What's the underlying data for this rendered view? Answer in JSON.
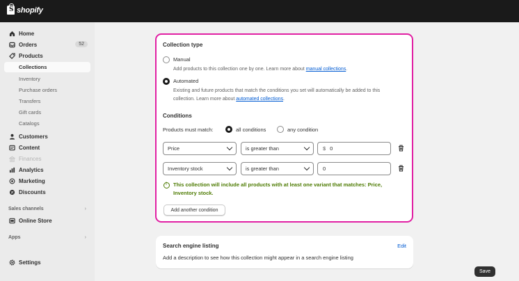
{
  "app": {
    "brand": "shopify"
  },
  "sidebar": {
    "items": [
      {
        "label": "Home",
        "icon": "home-icon"
      },
      {
        "label": "Orders",
        "icon": "orders-icon",
        "badge": "52"
      },
      {
        "label": "Products",
        "icon": "tag-icon"
      }
    ],
    "product_sub": [
      "Collections",
      "Inventory",
      "Purchase orders",
      "Transfers",
      "Gift cards",
      "Catalogs"
    ],
    "items2": [
      {
        "label": "Customers",
        "icon": "person-icon"
      },
      {
        "label": "Content",
        "icon": "content-icon"
      },
      {
        "label": "Finances",
        "icon": "bank-icon",
        "disabled": true
      },
      {
        "label": "Analytics",
        "icon": "chart-icon"
      },
      {
        "label": "Marketing",
        "icon": "target-icon"
      },
      {
        "label": "Discounts",
        "icon": "discount-icon"
      }
    ],
    "sales_channels_label": "Sales channels",
    "online_store": "Online Store",
    "apps_label": "Apps",
    "settings": "Settings"
  },
  "collection_type": {
    "title": "Collection type",
    "manual_label": "Manual",
    "manual_desc": "Add products to this collection one by one. Learn more about ",
    "manual_link": "manual collections",
    "manual_desc_end": ".",
    "automated_label": "Automated",
    "automated_desc_1": "Existing and future products that match the conditions you set will automatically be added to this",
    "automated_desc_2": "collection. Learn more about ",
    "automated_link": "automated collections",
    "automated_desc_end": ".",
    "selected": "Automated"
  },
  "conditions": {
    "title": "Conditions",
    "match_label": "Products must match:",
    "all_label": "all conditions",
    "any_label": "any condition",
    "selected": "all conditions",
    "rows": [
      {
        "field": "Price",
        "operator": "is greater than",
        "prefix": "$",
        "value": "0"
      },
      {
        "field": "Inventory stock",
        "operator": "is greater than",
        "prefix": "",
        "value": "0"
      }
    ],
    "note_line1": "This collection will include all products with at least one variant that matches: Price,",
    "note_line2": "Inventory stock.",
    "add_button": "Add another condition"
  },
  "seo": {
    "title": "Search engine listing",
    "edit": "Edit",
    "desc": "Add a description to see how this collection might appear in a search engine listing"
  },
  "save_label": "Save",
  "colors": {
    "accent_border": "#e11fa3",
    "link": "#005bd3",
    "success": "#4c7a00",
    "topbar": "#1a1a1a"
  }
}
